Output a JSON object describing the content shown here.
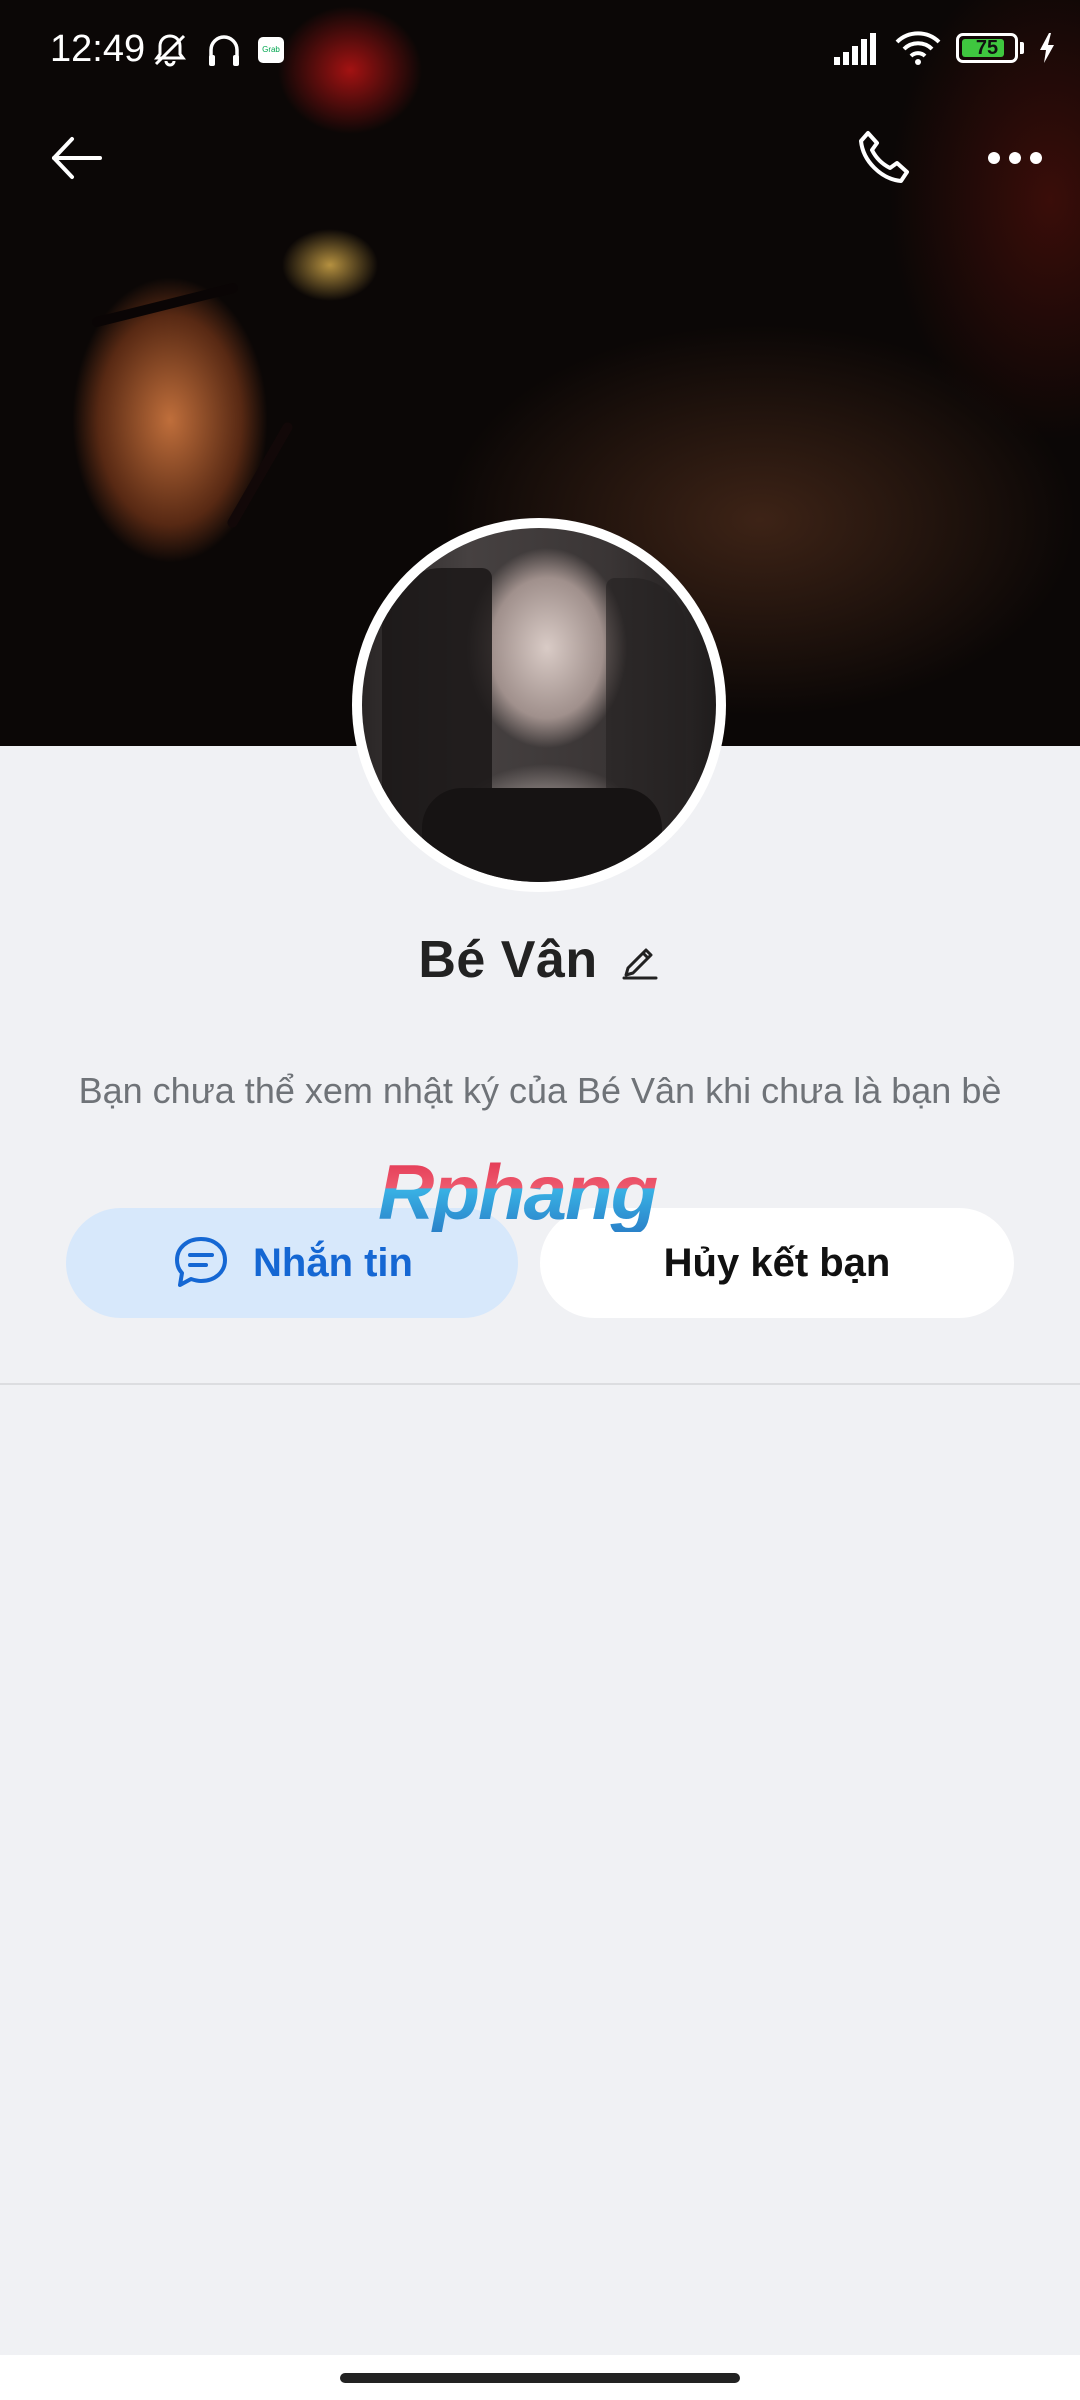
{
  "status_bar": {
    "time": "12:49",
    "battery_level": "75",
    "grab_icon_text": "Grab"
  },
  "nav": {
    "back_icon": "arrow-left-icon",
    "call_icon": "phone-icon",
    "more_icon": "more-dots-icon"
  },
  "profile": {
    "name": "Bé Vân",
    "info_text": "Bạn chưa thể xem nhật ký của Bé Vân khi chưa là bạn bè"
  },
  "actions": {
    "message_label": "Nhắn tin",
    "unfriend_label": "Hủy kết bạn"
  },
  "watermark": "Rphang",
  "colors": {
    "accent_blue": "#1567d3",
    "message_button_bg": "#d7e8fb",
    "page_bg": "#f0f1f4"
  }
}
